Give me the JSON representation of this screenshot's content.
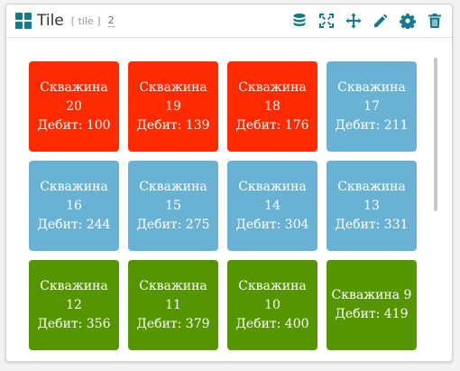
{
  "header": {
    "title": "Tile",
    "type_tag": "[ tile ]",
    "count": "2",
    "icon_color": "#107b8a",
    "tools": [
      {
        "name": "database-icon"
      },
      {
        "name": "fullscreen-icon"
      },
      {
        "name": "move-icon"
      },
      {
        "name": "edit-icon"
      },
      {
        "name": "gear-icon"
      },
      {
        "name": "trash-icon"
      }
    ]
  },
  "colors": {
    "red": "#ff2a00",
    "blue": "#6ab2d4",
    "green": "#559600"
  },
  "tiles": [
    {
      "name": "Скважина",
      "number": "20",
      "flow": "Дебит: 100",
      "color": "red"
    },
    {
      "name": "Скважина",
      "number": "19",
      "flow": "Дебит: 139",
      "color": "red"
    },
    {
      "name": "Скважина",
      "number": "18",
      "flow": "Дебит: 176",
      "color": "red"
    },
    {
      "name": "Скважина",
      "number": "17",
      "flow": "Дебит: 211",
      "color": "blue"
    },
    {
      "name": "Скважина",
      "number": "16",
      "flow": "Дебит: 244",
      "color": "blue"
    },
    {
      "name": "Скважина",
      "number": "15",
      "flow": "Дебит: 275",
      "color": "blue"
    },
    {
      "name": "Скважина",
      "number": "14",
      "flow": "Дебит: 304",
      "color": "blue"
    },
    {
      "name": "Скважина",
      "number": "13",
      "flow": "Дебит: 331",
      "color": "blue"
    },
    {
      "name": "Скважина",
      "number": "12",
      "flow": "Дебит: 356",
      "color": "green"
    },
    {
      "name": "Скважина",
      "number": "11",
      "flow": "Дебит: 379",
      "color": "green"
    },
    {
      "name": "Скважина",
      "number": "10",
      "flow": "Дебит: 400",
      "color": "green"
    },
    {
      "name": "Скважина 9",
      "number": "",
      "flow": "Дебит: 419",
      "color": "green"
    }
  ]
}
